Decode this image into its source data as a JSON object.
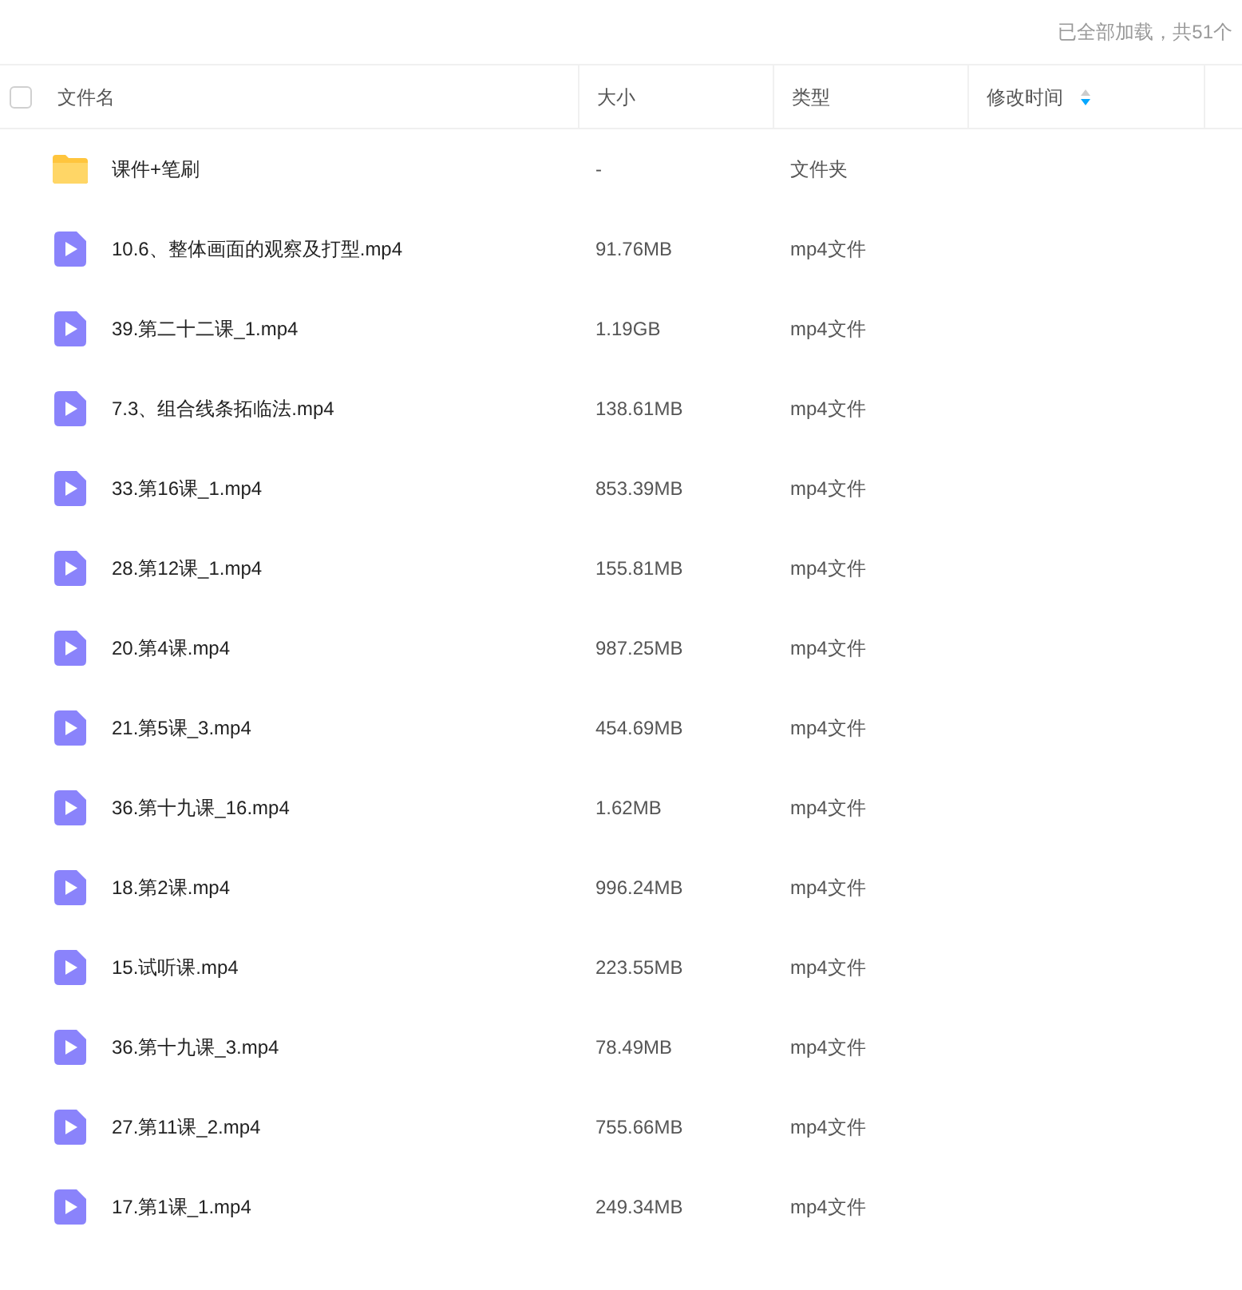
{
  "status_text": "已全部加载，共51个",
  "select_all": {
    "checked": false
  },
  "columns": [
    {
      "label": "文件名"
    },
    {
      "label": "大小"
    },
    {
      "label": "类型"
    },
    {
      "label": "修改时间",
      "sorted": true,
      "sort_descending": true
    }
  ],
  "rows": [
    {
      "kind": "folder",
      "name": "课件+笔刷",
      "size": "-",
      "type": "文件夹"
    },
    {
      "kind": "video",
      "name": "10.6、整体画面的观察及打型.mp4",
      "size": "91.76MB",
      "type": "mp4文件"
    },
    {
      "kind": "video",
      "name": "39.第二十二课_1.mp4",
      "size": "1.19GB",
      "type": "mp4文件"
    },
    {
      "kind": "video",
      "name": "7.3、组合线条拓临法.mp4",
      "size": "138.61MB",
      "type": "mp4文件"
    },
    {
      "kind": "video",
      "name": "33.第16课_1.mp4",
      "size": "853.39MB",
      "type": "mp4文件"
    },
    {
      "kind": "video",
      "name": "28.第12课_1.mp4",
      "size": "155.81MB",
      "type": "mp4文件"
    },
    {
      "kind": "video",
      "name": "20.第4课.mp4",
      "size": "987.25MB",
      "type": "mp4文件"
    },
    {
      "kind": "video",
      "name": "21.第5课_3.mp4",
      "size": "454.69MB",
      "type": "mp4文件"
    },
    {
      "kind": "video",
      "name": "36.第十九课_16.mp4",
      "size": "1.62MB",
      "type": "mp4文件"
    },
    {
      "kind": "video",
      "name": "18.第2课.mp4",
      "size": "996.24MB",
      "type": "mp4文件"
    },
    {
      "kind": "video",
      "name": "15.试听课.mp4",
      "size": "223.55MB",
      "type": "mp4文件"
    },
    {
      "kind": "video",
      "name": "36.第十九课_3.mp4",
      "size": "78.49MB",
      "type": "mp4文件"
    },
    {
      "kind": "video",
      "name": "27.第11课_2.mp4",
      "size": "755.66MB",
      "type": "mp4文件"
    },
    {
      "kind": "video",
      "name": "17.第1课_1.mp4",
      "size": "249.34MB",
      "type": "mp4文件"
    }
  ]
}
